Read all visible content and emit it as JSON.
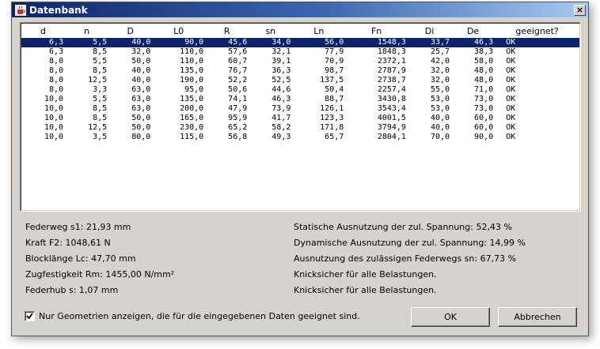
{
  "window": {
    "title": "Datenbank",
    "close_glyph": "×"
  },
  "table": {
    "columns": [
      "d",
      "n",
      "D",
      "L0",
      "R",
      "sn",
      "Ln",
      "Fn",
      "Di",
      "De",
      "geeignet?"
    ],
    "selected_row": 0,
    "rows": [
      [
        "6,3",
        "5,5",
        "40,0",
        "90,0",
        "45,6",
        "34,0",
        "56,0",
        "1548,3",
        "33,7",
        "46,3",
        "OK"
      ],
      [
        "6,3",
        "8,5",
        "32,0",
        "110,0",
        "57,6",
        "32,1",
        "77,9",
        "1848,3",
        "25,7",
        "38,3",
        "OK"
      ],
      [
        "8,0",
        "5,5",
        "50,0",
        "110,0",
        "60,7",
        "39,1",
        "70,9",
        "2372,1",
        "42,0",
        "58,0",
        "OK"
      ],
      [
        "8,0",
        "8,5",
        "40,0",
        "135,0",
        "76,7",
        "36,3",
        "98,7",
        "2787,9",
        "32,0",
        "48,0",
        "OK"
      ],
      [
        "8,0",
        "12,5",
        "40,0",
        "190,0",
        "52,2",
        "52,5",
        "137,5",
        "2738,7",
        "32,0",
        "48,0",
        "OK"
      ],
      [
        "8,0",
        "3,3",
        "63,0",
        "95,0",
        "50,6",
        "44,6",
        "50,4",
        "2257,4",
        "55,0",
        "71,0",
        "OK"
      ],
      [
        "10,0",
        "5,5",
        "63,0",
        "135,0",
        "74,1",
        "46,3",
        "88,7",
        "3430,8",
        "53,0",
        "73,0",
        "OK"
      ],
      [
        "10,0",
        "8,5",
        "63,0",
        "200,0",
        "47,9",
        "73,9",
        "126,1",
        "3543,4",
        "53,0",
        "73,0",
        "OK"
      ],
      [
        "10,0",
        "8,5",
        "50,0",
        "165,0",
        "95,9",
        "41,7",
        "123,3",
        "4001,5",
        "40,0",
        "60,0",
        "OK"
      ],
      [
        "10,0",
        "12,5",
        "50,0",
        "230,0",
        "65,2",
        "58,2",
        "171,8",
        "3794,9",
        "40,0",
        "60,0",
        "OK"
      ],
      [
        "10,0",
        "3,5",
        "80,0",
        "115,0",
        "56,8",
        "49,3",
        "65,7",
        "2804,1",
        "70,0",
        "90,0",
        "OK"
      ]
    ]
  },
  "info_left": {
    "federweg": "Federweg s1: 21,93 mm",
    "kraft": "Kraft F2: 1048,61 N",
    "blocklaenge": "Blocklänge Lc: 47,70 mm",
    "zugfestigkeit": "Zugfestigkeit Rm: 1455,00 N/mm²",
    "federhub": "Federhub s: 1,07 mm"
  },
  "info_right": {
    "statisch": "Statische Ausnutzung der zul. Spannung: 52,43 %",
    "dynamisch": "Dynamische Ausnutzung der zul. Spannung: 14,99 %",
    "federweg_ausnutzung": "Ausnutzung des zulässigen Federwegs sn: 67,73 %",
    "knick1": "Knicksicher für alle Belastungen.",
    "knick2": "Knicksicher für alle Belastungen."
  },
  "filter": {
    "label": "Nur Geometrien anzeigen, die für die eingegebenen Daten geeignet sind.",
    "checked": true
  },
  "buttons": {
    "ok": "OK",
    "cancel": "Abbrechen"
  },
  "colors": {
    "selection": "#0a246a",
    "titlebar_start": "#0b246a",
    "dialog_bg": "#d6d3ce"
  },
  "icons": {
    "app": "java-cup-icon",
    "close": "close-icon",
    "check": "checkmark-icon"
  }
}
